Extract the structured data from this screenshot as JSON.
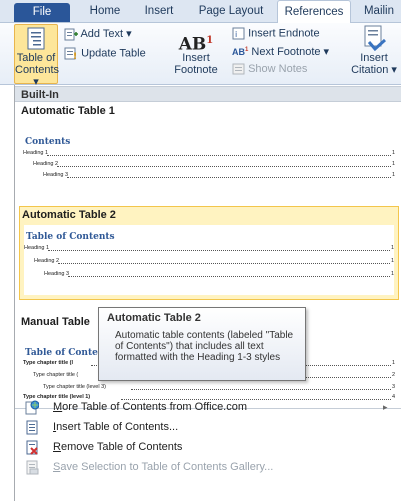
{
  "ribbon_tabs": [
    "File",
    "Home",
    "Insert",
    "Page Layout",
    "References",
    "Mailin"
  ],
  "ribbon": {
    "toc_btn": [
      "Table of",
      "Contents ▾"
    ],
    "add_text": "Add Text ▾",
    "update_table": "Update Table",
    "insert_footnote": [
      "Insert",
      "Footnote"
    ],
    "ab_glyph": "AB",
    "superscript": "1",
    "insert_endnote": "Insert Endnote",
    "next_footnote": "Next Footnote ▾",
    "show_notes": "Show Notes",
    "insert_citation": [
      "Insert",
      "Citation ▾"
    ]
  },
  "menu": {
    "section_builtin": "Built-In",
    "gallery": [
      {
        "title": "Automatic Table 1",
        "toc_title": "Contents",
        "lines": [
          "Heading 1",
          "Heading 2",
          "Heading 3"
        ],
        "pages": [
          "1",
          "1",
          "1"
        ]
      },
      {
        "title": "Automatic Table 2",
        "toc_title": "Table of Contents",
        "lines": [
          "Heading 1",
          "Heading 2",
          "Heading 3"
        ],
        "pages": [
          "1",
          "1",
          "1"
        ]
      },
      {
        "title": "Manual Table",
        "toc_title": "Table of Conte",
        "lines": [
          "Type chapter title (l",
          "Type chapter title (",
          "Type chapter title (level 3)",
          "Type chapter title (level 1)"
        ],
        "pages": [
          "1",
          "2",
          "3",
          "4"
        ]
      }
    ],
    "tooltip": {
      "title": "Automatic Table 2",
      "body": "Automatic table contents (labeled \"Table of Contents\") that includes all text formatted with the Heading 1-3 styles"
    },
    "items": [
      {
        "key": "M",
        "rest": "ore Table of Contents from Office.com",
        "arrow": "▸"
      },
      {
        "key": "I",
        "rest": "nsert Table of Contents..."
      },
      {
        "key": "R",
        "rest": "emove Table of Contents"
      },
      {
        "key": "S",
        "rest": "ave Selection to Table of Contents Gallery..."
      }
    ]
  }
}
